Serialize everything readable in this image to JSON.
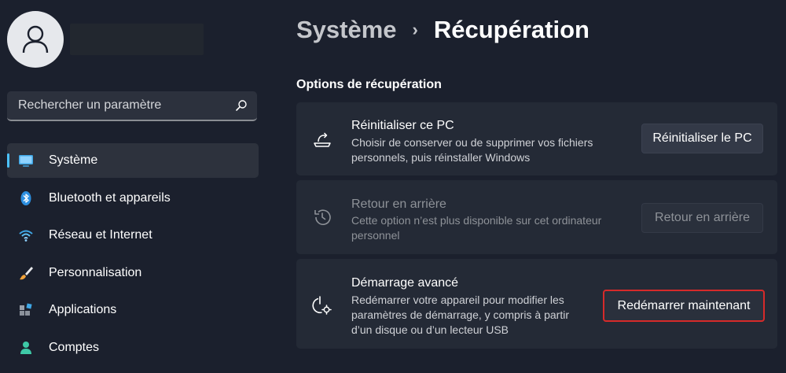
{
  "sidebar": {
    "search": {
      "placeholder": "Rechercher un paramètre"
    },
    "items": [
      {
        "label": "Système",
        "icon": "monitor-icon",
        "active": true
      },
      {
        "label": "Bluetooth et appareils",
        "icon": "bluetooth-icon"
      },
      {
        "label": "Réseau et Internet",
        "icon": "wifi-icon"
      },
      {
        "label": "Personnalisation",
        "icon": "brush-icon"
      },
      {
        "label": "Applications",
        "icon": "apps-icon"
      },
      {
        "label": "Comptes",
        "icon": "person-icon"
      }
    ]
  },
  "header": {
    "parent": "Système",
    "separator": "›",
    "current": "Récupération"
  },
  "section": {
    "title": "Options de récupération"
  },
  "cards": [
    {
      "title": "Réinitialiser ce PC",
      "description": "Choisir de conserver ou de supprimer vos fichiers personnels, puis réinstaller Windows",
      "button": "Réinitialiser le PC",
      "icon": "reset-pc-icon"
    },
    {
      "title": "Retour en arrière",
      "description": "Cette option n’est plus disponible sur cet ordinateur personnel",
      "button": "Retour en arrière",
      "icon": "history-icon",
      "disabled": true
    },
    {
      "title": "Démarrage avancé",
      "description": "Redémarrer votre appareil pour modifier les paramètres de démarrage, y compris à partir d’un disque ou d’un lecteur USB",
      "button": "Redémarrer maintenant",
      "icon": "advanced-startup-icon"
    }
  ],
  "colors": {
    "background": "#1b202d",
    "card": "#242a36",
    "accent": "#4cc2ff",
    "highlight": "#d62a2a"
  }
}
